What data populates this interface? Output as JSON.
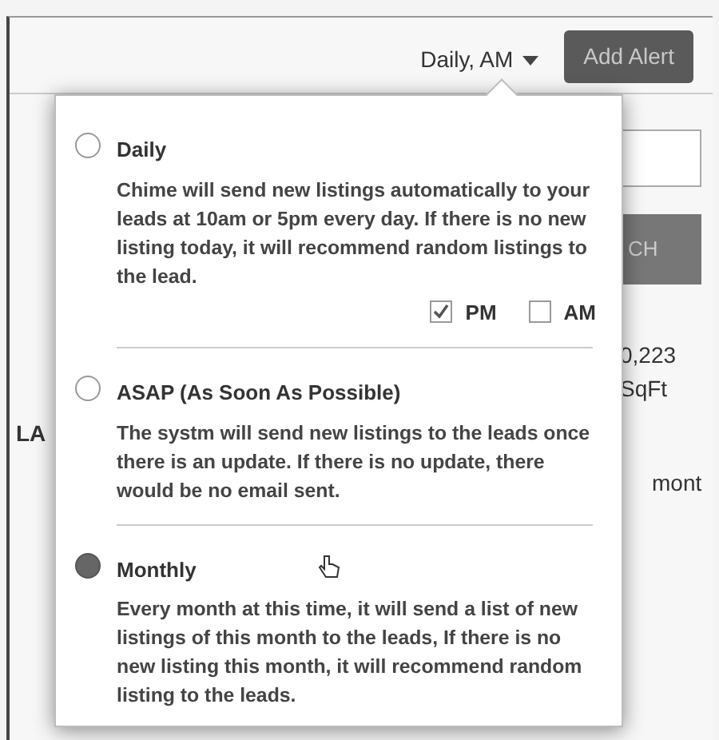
{
  "header": {
    "frequency_dropdown": "Daily, AM",
    "add_alert_button": "Add Alert"
  },
  "background": {
    "button_fragment": "CH",
    "price_fragment": "0,223",
    "unit_fragment": "SqFt",
    "heading_fragment": "LA",
    "text_fragment": "mont"
  },
  "options": [
    {
      "title": "Daily",
      "description": "Chime will send new listings automatically to your leads at 10am or 5pm every day. If there is no new listing today, it will recommend random listings to the lead.",
      "selected": false,
      "times": [
        {
          "label": "PM",
          "checked": true
        },
        {
          "label": "AM",
          "checked": false
        }
      ]
    },
    {
      "title": "ASAP (As Soon As Possible)",
      "description": "The systm will send new listings to the leads once there is an update. If there is no update, there would be no email sent.",
      "selected": false
    },
    {
      "title": "Monthly",
      "description": "Every month at this time, it will send a list of new listings of this month to the leads, If there is no new listing this month, it will recommend random listing to the leads.",
      "selected": true
    }
  ]
}
